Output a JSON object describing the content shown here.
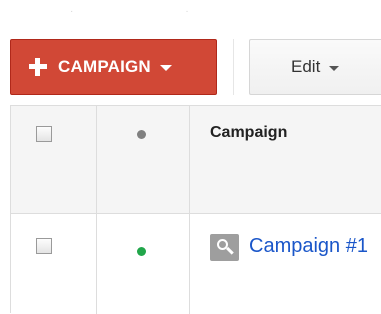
{
  "toolbar": {
    "campaign_button_label": "CAMPAIGN",
    "edit_button_label": "Edit"
  },
  "table": {
    "header": {
      "campaign_column": "Campaign",
      "status_dot_color": "#808080"
    },
    "rows": [
      {
        "status_dot_color": "#21a64a",
        "campaign_name": "Campaign #1",
        "icon": "search-icon"
      }
    ]
  },
  "colors": {
    "accent_red": "#d14836",
    "link_blue": "#1a56c9"
  }
}
